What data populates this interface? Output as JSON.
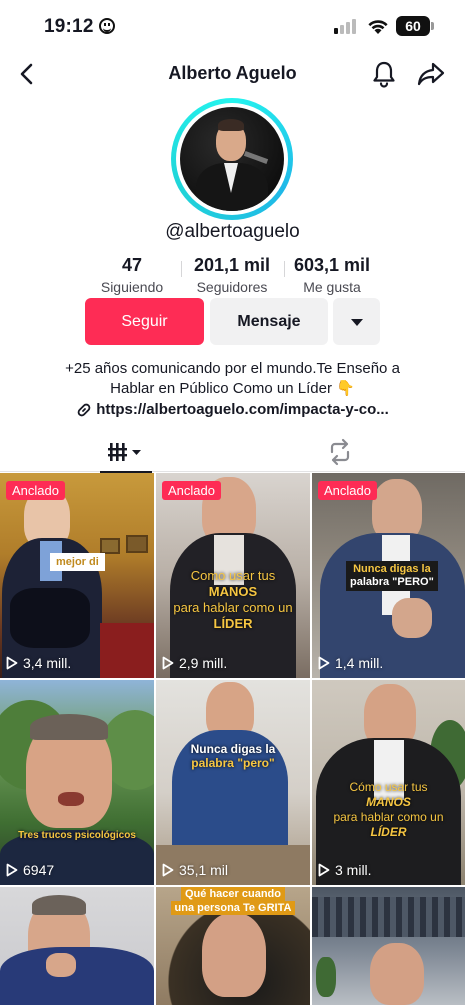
{
  "status_bar": {
    "time": "19:12",
    "battery": "60"
  },
  "header": {
    "title": "Alberto Aguelo"
  },
  "profile": {
    "handle": "@albertoaguelo",
    "stats": [
      {
        "value": "47",
        "label": "Siguiendo"
      },
      {
        "value": "201,1 mil",
        "label": "Seguidores"
      },
      {
        "value": "603,1 mil",
        "label": "Me gusta"
      }
    ],
    "follow_label": "Seguir",
    "message_label": "Mensaje",
    "bio_line1": "+25 años comunicando por el mundo.Te Enseño a",
    "bio_line2": "Hablar en Público Como un Líder 👇",
    "link": "https://albertoaguelo.com/impacta-y-co..."
  },
  "colors": {
    "accent": "#fe2c55",
    "ring": "#25f4ee"
  },
  "videos": [
    {
      "pinned_label": "Anclado",
      "views": "3,4 mill.",
      "caption": "mejor di"
    },
    {
      "pinned_label": "Anclado",
      "views": "2,9 mill.",
      "caption_line1": "Como usar tus",
      "caption_line2": "MANOS",
      "caption_line3": "para hablar como un",
      "caption_line4": "LÍDER"
    },
    {
      "pinned_label": "Anclado",
      "views": "1,4 mill.",
      "caption_line1": "Nunca digas la",
      "caption_line2": "palabra \"PERO\""
    },
    {
      "views": "6947",
      "caption": "Tres trucos psicológicos"
    },
    {
      "views": "35,1 mil",
      "caption_line1": "Nunca digas la",
      "caption_line2": "palabra \"pero\""
    },
    {
      "views": "3 mill.",
      "caption_line1": "Cómo usar tus",
      "caption_line2": "MANOS",
      "caption_line3": "para hablar como un",
      "caption_line4": "LÍDER"
    },
    {
      "views": ""
    },
    {
      "views": "",
      "caption_line1": "Qué hacer cuando",
      "caption_line2": "una persona Te GRITA"
    },
    {
      "views": ""
    }
  ]
}
